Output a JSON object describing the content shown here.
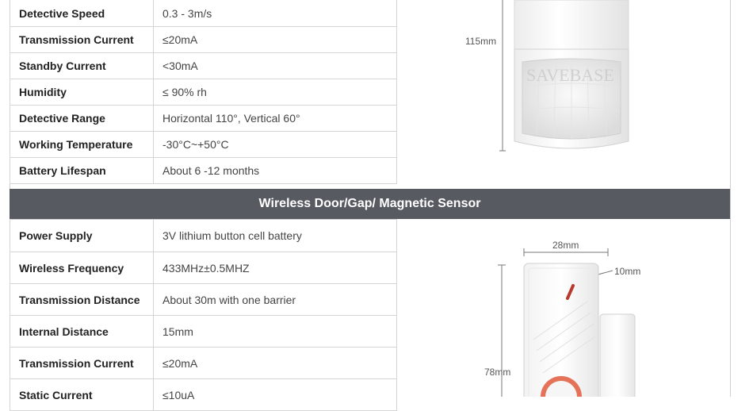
{
  "pir_specs": [
    {
      "label": "Detective Speed",
      "value": "0.3 - 3m/s"
    },
    {
      "label": "Transmission Current",
      "value": "≤20mA"
    },
    {
      "label": "Standby Current",
      "value": "<30mA"
    },
    {
      "label": "Humidity",
      "value": "≤ 90% rh"
    },
    {
      "label": "Detective Range",
      "value": "Horizontal 110°, Vertical 60°"
    },
    {
      "label": "Working Temperature",
      "value": "-30°C~+50°C"
    },
    {
      "label": "Battery Lifespan",
      "value": "About 6 -12 months"
    }
  ],
  "pir_image": {
    "height_label": "115mm",
    "watermark": "SAVEBASE"
  },
  "door_sensor": {
    "title": "Wireless Door/Gap/ Magnetic Sensor",
    "specs": [
      {
        "label": "Power Supply",
        "value": "3V lithium button cell battery"
      },
      {
        "label": "Wireless Frequency",
        "value": "433MHz±0.5MHZ"
      },
      {
        "label": "Transmission Distance",
        "value": "About 30m with one barrier"
      },
      {
        "label": "Internal Distance",
        "value": "15mm"
      },
      {
        "label": "Transmission Current",
        "value": "≤20mA"
      },
      {
        "label": "Static Current",
        "value": "≤10uA"
      }
    ],
    "width_label": "28mm",
    "depth_label": "10mm",
    "height_label": "78mm"
  }
}
